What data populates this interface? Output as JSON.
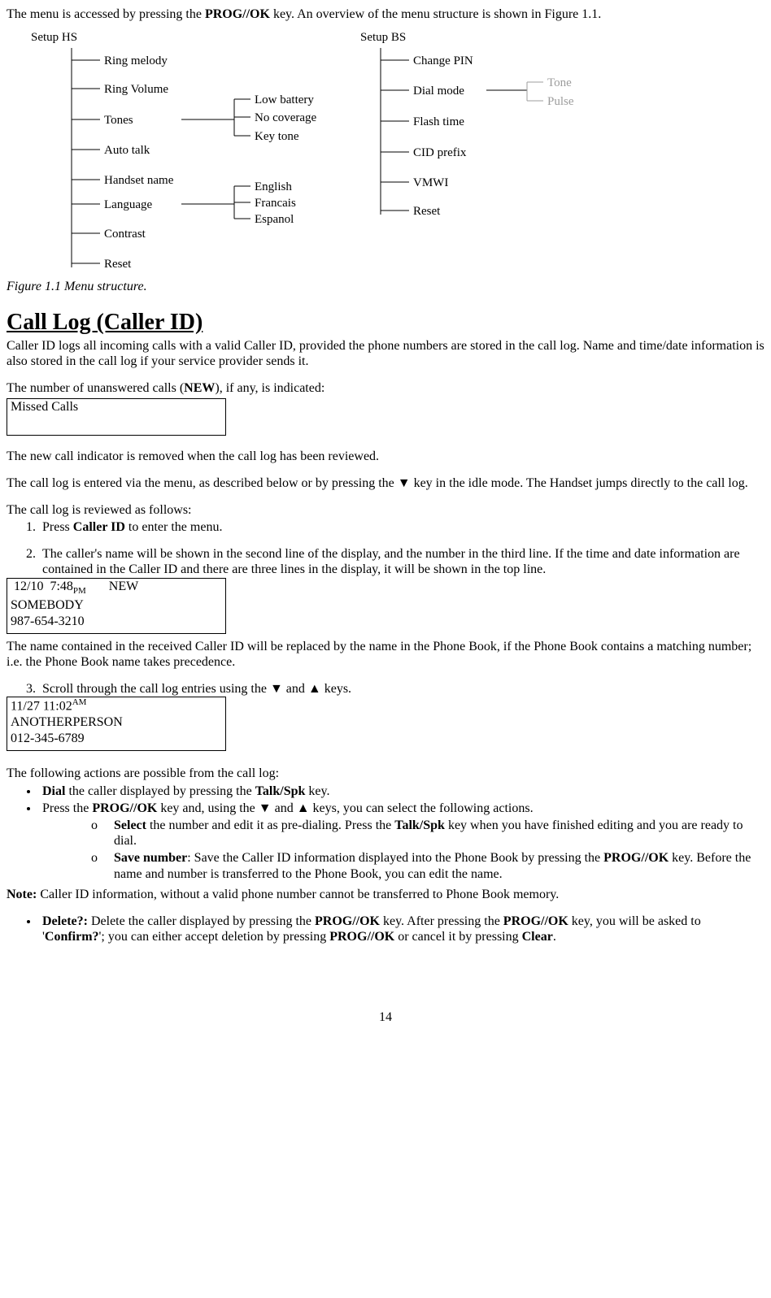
{
  "intro": {
    "pre": "The menu is accessed by pressing the ",
    "key": "PROG//OK",
    "post": " key. An overview of the menu structure is shown in Figure 1.1."
  },
  "diagram": {
    "hs_title": "Setup HS",
    "bs_title": "Setup BS",
    "hs_items": [
      "Ring melody",
      "Ring Volume",
      "Tones",
      "Auto talk",
      "Handset name",
      "Language",
      "Contrast",
      "Reset"
    ],
    "tones_sub": [
      "Low battery",
      "No coverage",
      "Key tone"
    ],
    "lang_sub": [
      "English",
      "Francais",
      "Espanol"
    ],
    "bs_items": [
      "Change PIN",
      "Dial  mode",
      "Flash time",
      "CID prefix",
      "VMWI",
      "Reset"
    ],
    "dial_sub": [
      "Tone",
      "Pulse"
    ]
  },
  "figcap": "Figure 1.1 Menu structure.",
  "section_title": "Call Log (Caller ID)",
  "p1": "Caller ID logs all incoming calls with a valid Caller ID, provided the phone numbers are stored in the call log. Name and time/date information is also stored in the call log if your service provider sends it.",
  "p2_pre": "The number of unanswered calls (",
  "p2_mid": "NEW",
  "p2_post": "), if any, is indicated:",
  "lcd1_line1": "Missed Calls",
  "p3": "The new call indicator is removed when the call log has been reviewed.",
  "p4": "The call log is entered via the menu, as described below or by pressing the ▼ key in the idle mode. The Handset jumps directly to the call log.",
  "p5": "The call log is reviewed as follows:",
  "step1_pre": "Press ",
  "step1_b": "Caller ID",
  "step1_post": " to enter the menu.",
  "step2": "The caller's name will be shown in the second line of the display, and the number in the third line. If the time and date information are contained in the Caller ID and there are three lines in the display, it will be shown in the top line.",
  "lcd2": {
    "date": " 12/10  7:48",
    "ampm": "PM",
    "new": "       NEW",
    "name": "SOMEBODY",
    "number": "987-654-3210"
  },
  "p6": "The name contained in the received Caller ID will be replaced by the name in the Phone Book, if the Phone Book contains a matching number; i.e. the Phone Book name takes precedence.",
  "step3": "Scroll through the call log entries using the ▼ and ▲  keys.",
  "lcd3": {
    "date": "11/27 11:02",
    "ampm": "AM",
    "name": "ANOTHERPERSON",
    "number": "012-345-6789"
  },
  "p7": "The following actions are possible from the call log:",
  "bul1_b1": "Dial",
  "bul1_mid": " the caller displayed by pressing the ",
  "bul1_b2": "Talk/Spk",
  "bul1_end": " key.",
  "bul2_pre": "Press the ",
  "bul2_b": "PROG//OK",
  "bul2_post": " key and, using the ▼ and ▲  keys, you can select the following actions.",
  "sub_o": "o",
  "sub1_b": "Select",
  "sub1_mid": " the number and edit it as pre-dialing.  Press the ",
  "sub1_b2": "Talk/Spk",
  "sub1_end": " key when you have finished editing and you are ready to dial.",
  "sub2_b": "Save number",
  "sub2_mid": ": Save the Caller ID information displayed into the Phone Book by pressing the ",
  "sub2_b2": "PROG//OK",
  "sub2_end": " key. Before the name and number is transferred to the Phone Book, you can edit the name.",
  "note_b": "Note:",
  "note_text": " Caller ID information, without a valid phone number cannot be transferred to Phone Book memory.",
  "bul3_b1": "Delete?:",
  "bul3_t1": " Delete the caller displayed by pressing the ",
  "bul3_b2": "PROG//OK",
  "bul3_t2": " key.  After pressing the ",
  "bul3_b3": "PROG//OK",
  "bul3_t3": " key, you will be asked to '",
  "bul3_b4": "Confirm?",
  "bul3_t4": "'; you can either accept deletion by pressing ",
  "bul3_b5": "PROG//OK",
  "bul3_t5": " or cancel it by pressing ",
  "bul3_b6": "Clear",
  "bul3_t6": ".",
  "pagenum": "14"
}
